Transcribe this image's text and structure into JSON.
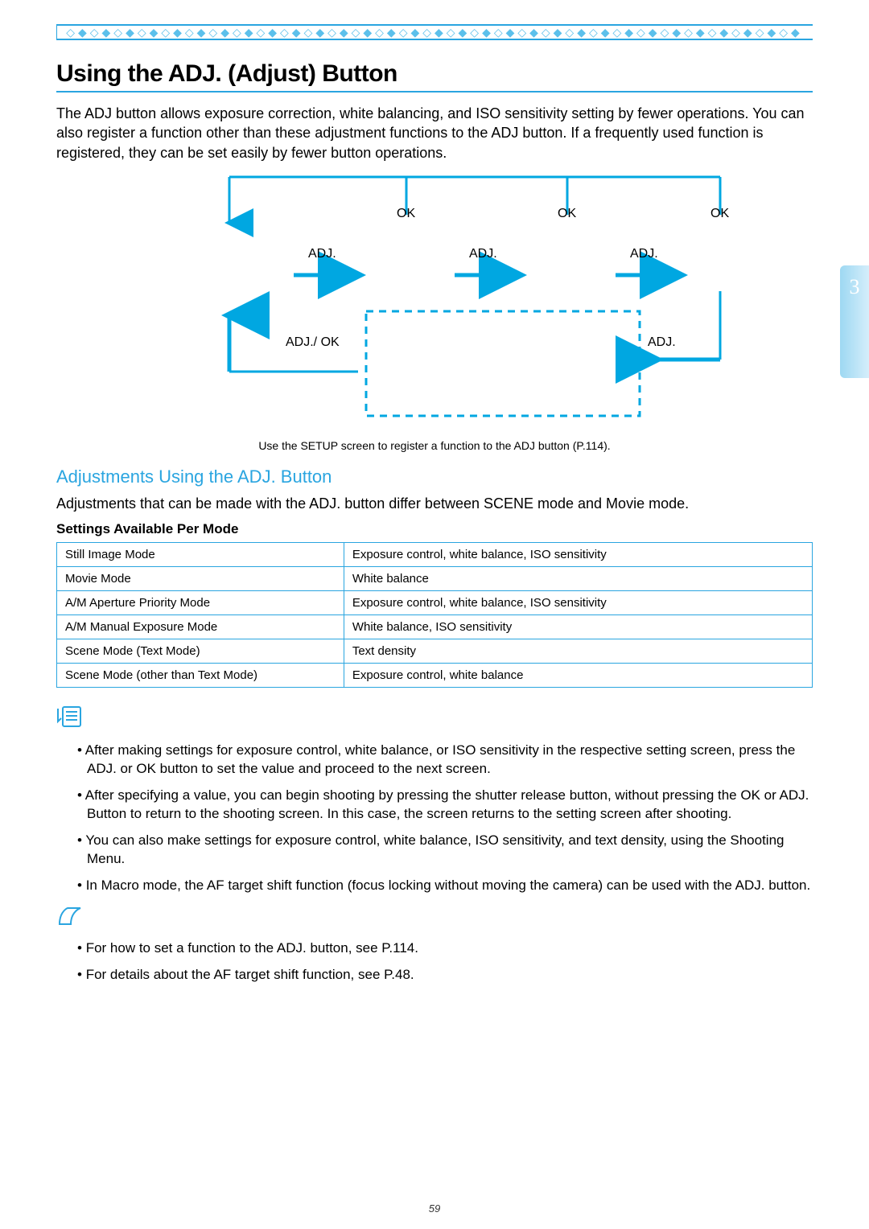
{
  "pageNumber": "59",
  "chapterTab": "3",
  "title": "Using the ADJ. (Adjust) Button",
  "intro": "The ADJ button allows exposure correction, white balancing, and ISO sensitivity setting by fewer operations. You can also register a function other than these adjustment functions to the ADJ button. If a frequently used function is registered, they can be set easily by fewer button operations.",
  "diagram": {
    "ok1": "OK",
    "ok2": "OK",
    "ok3": "OK",
    "adj1": "ADJ.",
    "adj2": "ADJ.",
    "adj3": "ADJ.",
    "adjok": "ADJ./",
    "adjok_ok": "OK",
    "adj4": "ADJ."
  },
  "setupNote": "Use the SETUP screen to register a function to the ADJ button (P.114).",
  "subhead": "Adjustments Using the ADJ. Button",
  "subintro": "Adjustments that can be made with the ADJ. button differ between SCENE mode and Movie mode.",
  "settingsLabel": "Settings Available Per Mode",
  "table": [
    {
      "mode": "Still Image Mode",
      "settings": "Exposure control, white balance, ISO sensitivity"
    },
    {
      "mode": "Movie Mode",
      "settings": "White balance"
    },
    {
      "mode": "A/M Aperture Priority Mode",
      "settings": "Exposure control, white balance, ISO sensitivity"
    },
    {
      "mode": "A/M Manual Exposure Mode",
      "settings": "White balance, ISO sensitivity"
    },
    {
      "mode": "Scene Mode (Text Mode)",
      "settings": "Text density"
    },
    {
      "mode": "Scene Mode (other than Text Mode)",
      "settings": "Exposure control, white balance"
    }
  ],
  "notes": [
    "After making settings for exposure control, white balance, or ISO sensitivity in the respective setting screen, press the ADJ. or OK button to set the value and proceed to the next screen.",
    "After specifying a value, you can begin shooting by pressing the shutter release button, without pressing the OK or ADJ. Button to return to the shooting screen. In this case, the screen returns to the setting screen after shooting.",
    "You can also make settings for exposure control, white balance, ISO sensitivity, and text density, using the Shooting Menu.",
    "In Macro mode, the AF target shift function (focus locking without moving the camera) can be used with the ADJ. button."
  ],
  "refs": [
    "For how to set a function to the ADJ. button, see P.114.",
    "For details about the AF target shift function, see P.48."
  ]
}
